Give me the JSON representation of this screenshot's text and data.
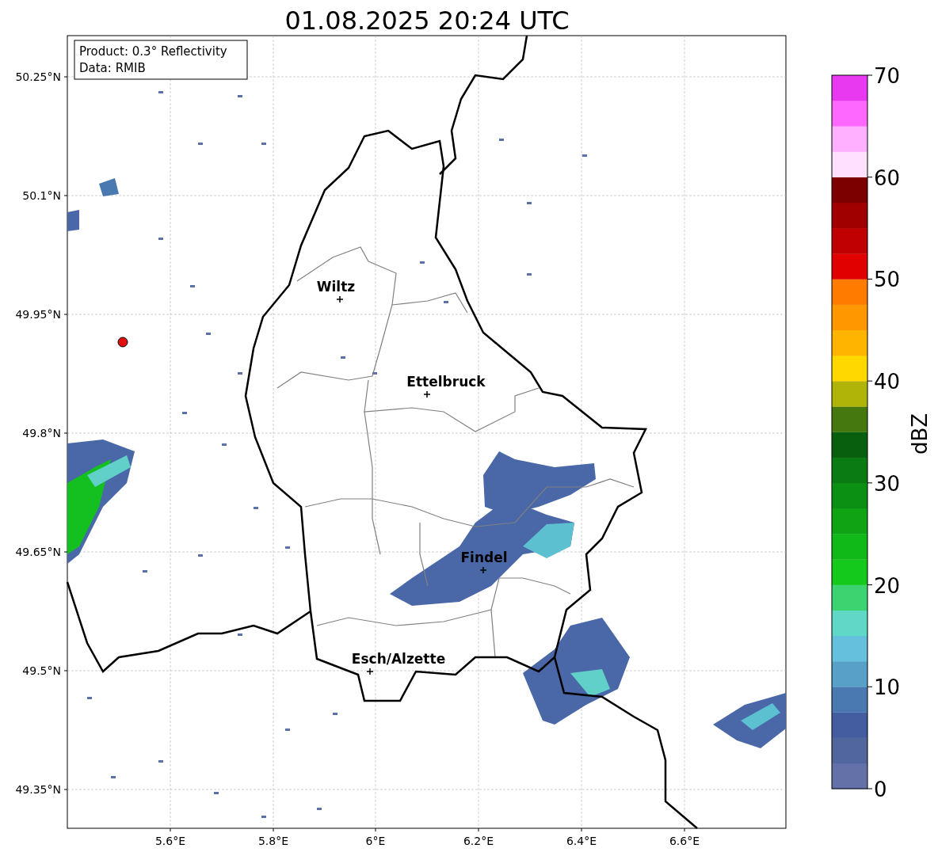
{
  "title": "01.08.2025 20:24 UTC",
  "info_box": {
    "lines": [
      "Product: 0.3° Reflectivity",
      "Data: RMIB"
    ]
  },
  "lat_labels": [
    "50.25°N",
    "50.1°N",
    "49.95°N",
    "49.8°N",
    "49.65°N",
    "49.5°N",
    "49.35°N"
  ],
  "lon_labels": [
    "5.6°E",
    "5.8°E",
    "6°E",
    "6.2°E",
    "6.4°E",
    "6.6°E"
  ],
  "cities": [
    {
      "name": "Wiltz"
    },
    {
      "name": "Ettelbruck"
    },
    {
      "name": "Findel"
    },
    {
      "name": "Esch/Alzette"
    }
  ],
  "colorbar": {
    "label": "dBZ",
    "ticks": [
      "70",
      "60",
      "50",
      "40",
      "30",
      "20",
      "10",
      "0"
    ],
    "segments": [
      {
        "color": "#6470a8"
      },
      {
        "color": "#52669e"
      },
      {
        "color": "#445ca0"
      },
      {
        "color": "#4a78b0"
      },
      {
        "color": "#58a0c8"
      },
      {
        "color": "#64c0dc"
      },
      {
        "color": "#60d8c8"
      },
      {
        "color": "#3cd470"
      },
      {
        "color": "#14c81c"
      },
      {
        "color": "#10b818"
      },
      {
        "color": "#10a414"
      },
      {
        "color": "#0c9014"
      },
      {
        "color": "#0a7a12"
      },
      {
        "color": "#08600e"
      },
      {
        "color": "#467810"
      },
      {
        "color": "#b0b408"
      },
      {
        "color": "#ffd800"
      },
      {
        "color": "#ffb400"
      },
      {
        "color": "#ff9800"
      },
      {
        "color": "#ff7c00"
      },
      {
        "color": "#e00000"
      },
      {
        "color": "#c00000"
      },
      {
        "color": "#a00000"
      },
      {
        "color": "#7c0000"
      },
      {
        "color": "#ffe0ff"
      },
      {
        "color": "#ffb0ff"
      },
      {
        "color": "#ff68ff"
      },
      {
        "color": "#e838f0"
      }
    ]
  }
}
